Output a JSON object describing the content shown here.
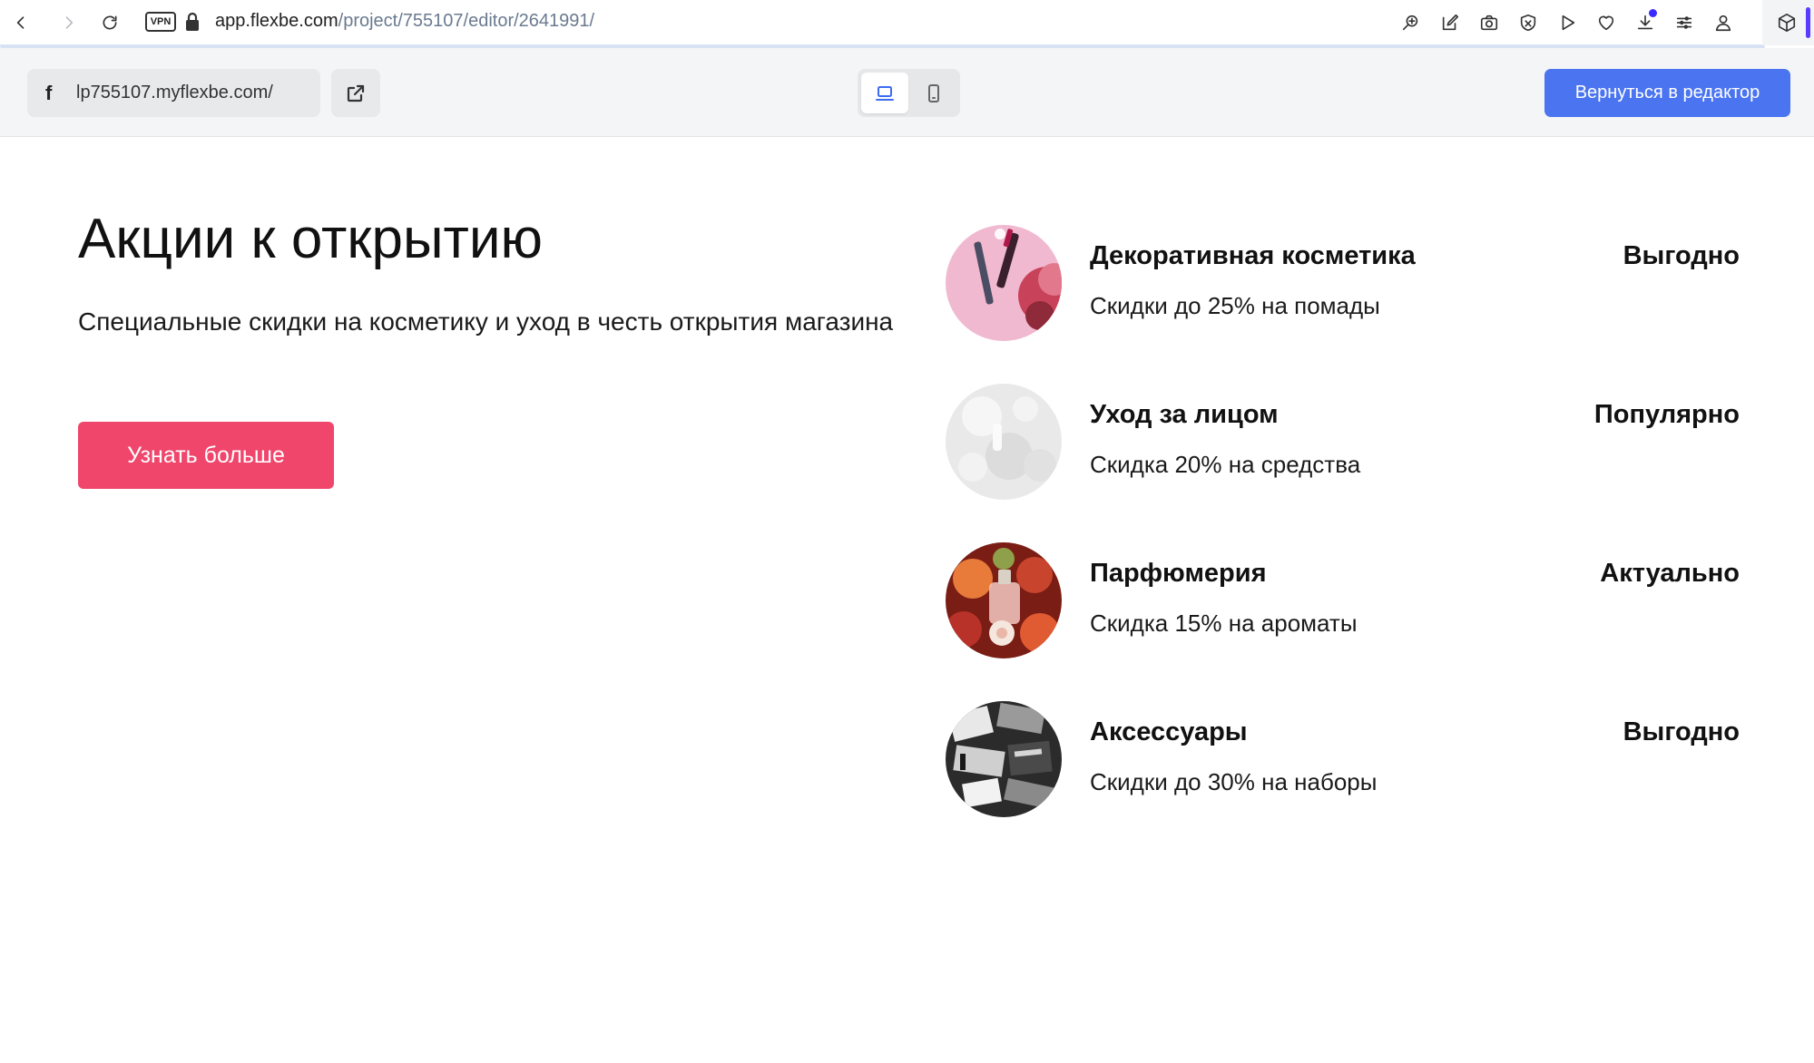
{
  "browser": {
    "url_host": "app.flexbe.com",
    "url_path": "/project/755107/editor/2641991/",
    "vpn_label": "VPN"
  },
  "toolbar": {
    "domain": "lp755107.myflexbe.com/",
    "domain_icon": "f",
    "back_button_label": "Вернуться в редактор",
    "active_device": "desktop"
  },
  "hero": {
    "title": "Акции к открытию",
    "subtitle": "Специальные скидки на косметику и уход в честь открытия магазина",
    "button_label": "Узнать больше",
    "button_color": "#f0466c"
  },
  "offers": [
    {
      "name": "Декоративная косметика",
      "description": "Скидки до 25% на помады",
      "tag": "Выгодно",
      "image": "lipsticks-photo"
    },
    {
      "name": "Уход за лицом",
      "description": "Скидка 20% на средства",
      "tag": "Популярно",
      "image": "white-cosmetics-photo"
    },
    {
      "name": "Парфюмерия",
      "description": "Скидка 15% на ароматы",
      "tag": "Актуально",
      "image": "perfume-flowers-photo"
    },
    {
      "name": "Аксессуары",
      "description": "Скидки до 30% на наборы",
      "tag": "Выгодно",
      "image": "makeup-palettes-bw-photo"
    }
  ],
  "colors": {
    "accent_blue": "#4a74f0",
    "cta_pink": "#f0466c"
  }
}
